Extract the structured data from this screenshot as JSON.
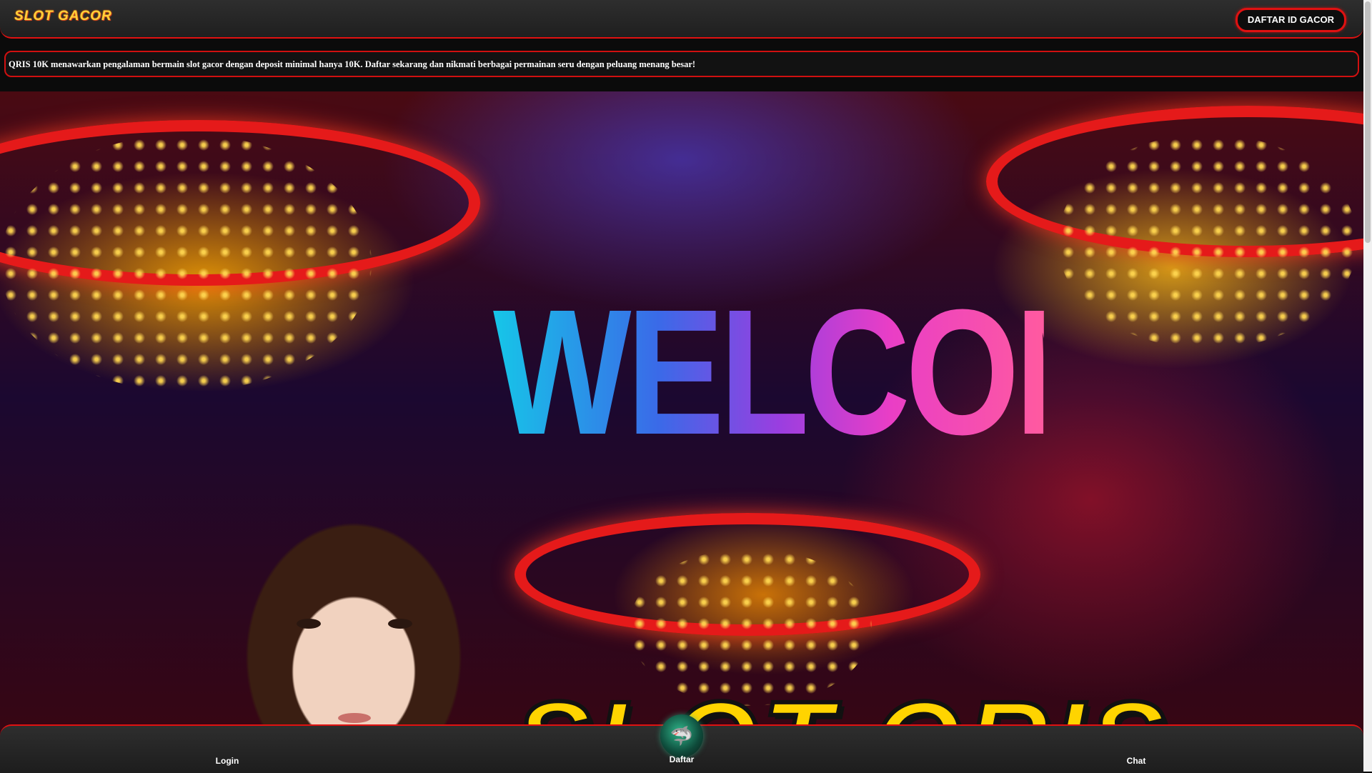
{
  "header": {
    "logo_text": "SLOT GACOR",
    "cta_label": "DAFTAR ID GACOR"
  },
  "marquee": {
    "text": "QRIS 10K menawarkan pengalaman bermain slot gacor dengan deposit minimal hanya 10K. Daftar sekarang dan nikmati berbagai permainan seru dengan peluang menang besar!"
  },
  "hero": {
    "welcome_text": "WELCOME",
    "title_text": "SLOT QRIS"
  },
  "bottom_nav": {
    "items": [
      {
        "label": "Login"
      },
      {
        "label": "Daftar",
        "icon": "shark-icon"
      },
      {
        "label": "Chat"
      }
    ]
  },
  "colors": {
    "accent": "#e01111",
    "bar_bg": "#262626",
    "title_yellow": "#ffd400"
  }
}
